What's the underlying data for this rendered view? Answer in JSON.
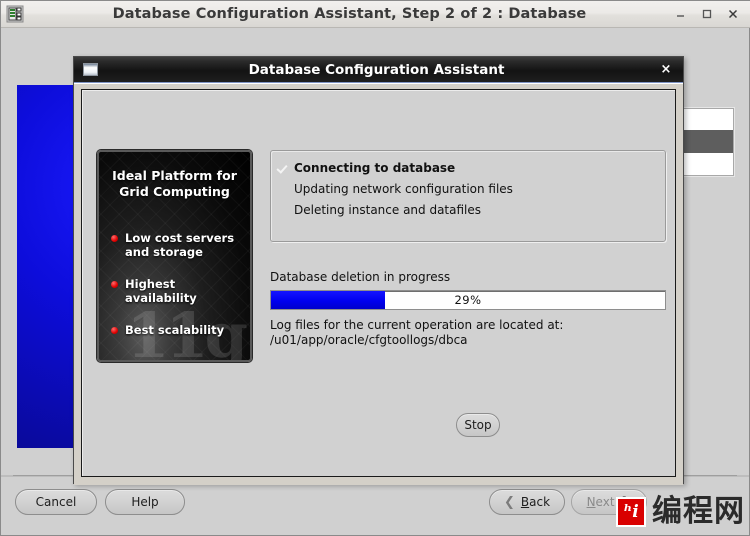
{
  "outer_window": {
    "title": "Database Configuration Assistant, Step 2 of 2 : Database",
    "icon": "database-app-icon",
    "controls": {
      "minimize": "minimize-icon",
      "maximize": "maximize-icon",
      "close": "close-icon"
    }
  },
  "wizard_buttons": {
    "cancel": "Cancel",
    "help": "Help",
    "back": "Back",
    "back_mnemonic": "B",
    "next": "Next",
    "next_mnemonic": "N",
    "back_icon": "chevron-left-icon",
    "next_icon": "chevron-right-icon"
  },
  "modal": {
    "title": "Database Configuration Assistant",
    "icon": "window-app-icon",
    "close": "×"
  },
  "promo": {
    "heading_line1": "Ideal Platform for",
    "heading_line2": "Grid Computing",
    "ghost_text": "11g",
    "items": [
      {
        "line1": "Low cost servers",
        "line2": "and storage"
      },
      {
        "line1": "Highest availability",
        "line2": ""
      },
      {
        "line1": "Best scalability",
        "line2": ""
      }
    ]
  },
  "status": {
    "rows": [
      {
        "label": "Connecting to database",
        "done": true
      },
      {
        "label": "Updating network configuration files",
        "done": false
      },
      {
        "label": "Deleting instance and datafiles",
        "done": false
      }
    ]
  },
  "progress": {
    "label": "Database deletion in progress",
    "percent_text": "29%",
    "percent_value": 29
  },
  "log": {
    "line1": "Log files for the current operation are located at:",
    "line2": "/u01/app/oracle/cfgtoollogs/dbca"
  },
  "stop_button": {
    "label": "Stop"
  },
  "watermark": {
    "logo_text": "ʰⅰ",
    "text": "编程网",
    "accent_color": "#d90000"
  },
  "colors": {
    "progress_fill": "#0000f0",
    "titlebar_dark": "#131313",
    "window_bg": "#d4d0c8",
    "selection": "#5e5e5e"
  }
}
